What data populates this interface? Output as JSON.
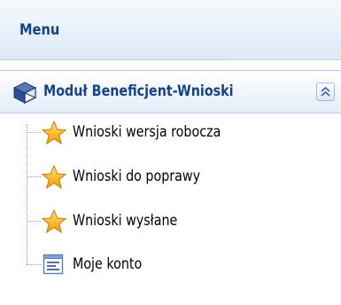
{
  "menu": {
    "title": "Menu"
  },
  "section": {
    "title": "Moduł Beneficjent-Wnioski",
    "icon": "module-cube-icon",
    "collapse_icon": "collapse-chevrons-up-icon"
  },
  "tree": {
    "items": [
      {
        "label": "Wnioski wersja robocza",
        "icon": "star-icon"
      },
      {
        "label": "Wnioski do poprawy",
        "icon": "star-icon"
      },
      {
        "label": "Wnioski wysłane",
        "icon": "star-icon"
      },
      {
        "label": "Moje konto",
        "icon": "account-form-icon"
      }
    ]
  },
  "colors": {
    "header_text": "#15428b",
    "star_fill": "#f5b400",
    "border": "#99bbe8"
  }
}
